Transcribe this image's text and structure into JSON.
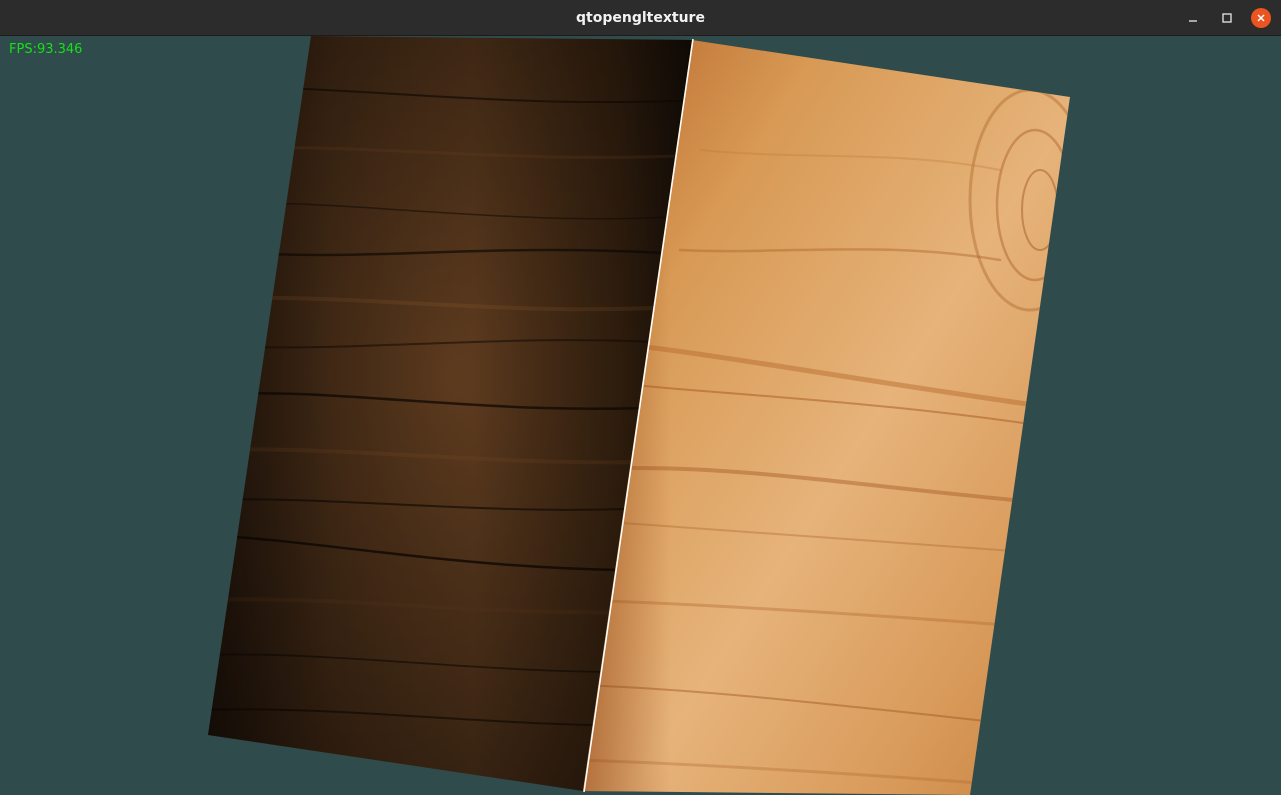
{
  "window": {
    "title": "qtopengltexture"
  },
  "overlay": {
    "fps_text": "FPS:93.346"
  },
  "titlebar_buttons": {
    "minimize_icon": "minimize-icon",
    "maximize_icon": "maximize-icon",
    "close_icon": "close-icon"
  },
  "colors": {
    "background": "#2f4b4b",
    "titlebar": "#2c2c2c",
    "fps_text": "#18e018",
    "close_button": "#e95420"
  }
}
